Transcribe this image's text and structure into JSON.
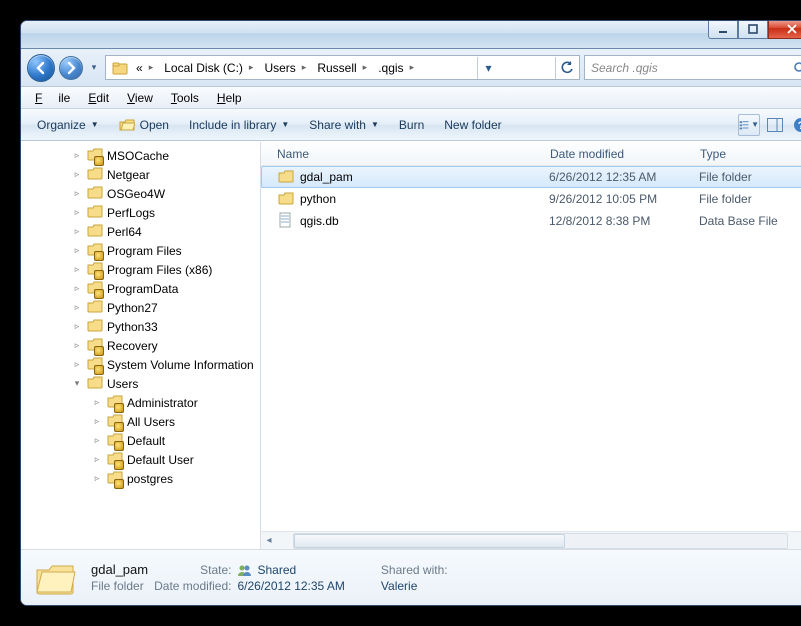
{
  "titlebar": {
    "min": "_",
    "max": "▢",
    "close": "✕"
  },
  "nav": {
    "breadcrumb": [
      "Local Disk (C:)",
      "Users",
      "Russell",
      ".qgis"
    ],
    "search_placeholder": "Search .qgis"
  },
  "menubar": {
    "file": "File",
    "edit": "Edit",
    "view": "View",
    "tools": "Tools",
    "help": "Help"
  },
  "toolbar": {
    "organize": "Organize",
    "open": "Open",
    "include": "Include in library",
    "share": "Share with",
    "burn": "Burn",
    "newfolder": "New folder"
  },
  "tree": {
    "items": [
      {
        "label": "MSOCache",
        "locked": true,
        "indent": 1
      },
      {
        "label": "Netgear",
        "locked": false,
        "indent": 1
      },
      {
        "label": "OSGeo4W",
        "locked": false,
        "indent": 1
      },
      {
        "label": "PerfLogs",
        "locked": false,
        "indent": 1
      },
      {
        "label": "Perl64",
        "locked": false,
        "indent": 1
      },
      {
        "label": "Program Files",
        "locked": true,
        "indent": 1
      },
      {
        "label": "Program Files (x86)",
        "locked": true,
        "indent": 1
      },
      {
        "label": "ProgramData",
        "locked": true,
        "indent": 1
      },
      {
        "label": "Python27",
        "locked": false,
        "indent": 1
      },
      {
        "label": "Python33",
        "locked": false,
        "indent": 1
      },
      {
        "label": "Recovery",
        "locked": true,
        "indent": 1
      },
      {
        "label": "System Volume Information",
        "locked": true,
        "indent": 1
      },
      {
        "label": "Users",
        "locked": false,
        "indent": 1,
        "expanded": true
      },
      {
        "label": "Administrator",
        "locked": true,
        "indent": 2
      },
      {
        "label": "All Users",
        "locked": true,
        "indent": 2
      },
      {
        "label": "Default",
        "locked": true,
        "indent": 2
      },
      {
        "label": "Default User",
        "locked": true,
        "indent": 2
      },
      {
        "label": "postgres",
        "locked": true,
        "indent": 2
      }
    ]
  },
  "columns": {
    "name": "Name",
    "date": "Date modified",
    "type": "Type"
  },
  "rows": [
    {
      "icon": "folder",
      "name": "gdal_pam",
      "date": "6/26/2012 12:35 AM",
      "type": "File folder",
      "selected": true
    },
    {
      "icon": "folder",
      "name": "python",
      "date": "9/26/2012 10:05 PM",
      "type": "File folder",
      "selected": false
    },
    {
      "icon": "db",
      "name": "qgis.db",
      "date": "12/8/2012 8:38 PM",
      "type": "Data Base File",
      "selected": false
    }
  ],
  "details": {
    "name": "gdal_pam",
    "type": "File folder",
    "state_k": "State:",
    "state_v": "Shared",
    "mod_k": "Date modified:",
    "mod_v": "6/26/2012 12:35 AM",
    "sharedwith_k": "Shared with:",
    "sharedwith_v": "Valerie"
  }
}
